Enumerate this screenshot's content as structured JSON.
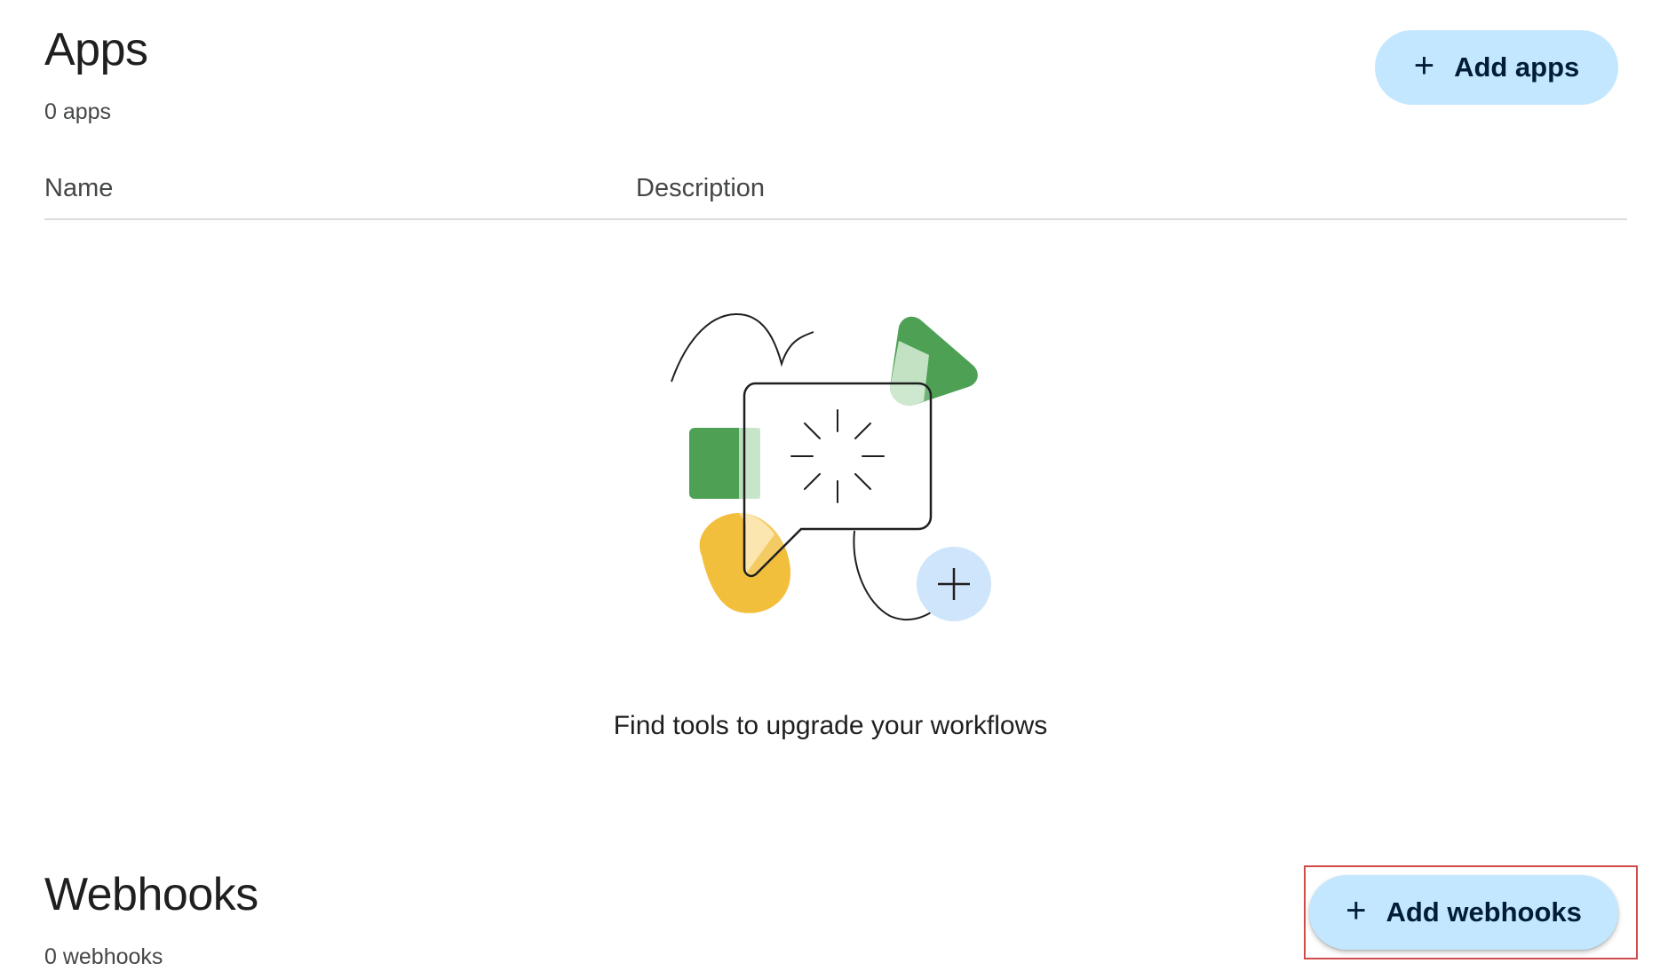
{
  "apps": {
    "title": "Apps",
    "count": "0 apps",
    "add_button_label": "Add apps"
  },
  "table": {
    "columns": [
      "Name",
      "Description"
    ]
  },
  "empty_state": {
    "illustration_icon": "chat-bubble-sparkle-illustration",
    "message": "Find tools to upgrade your workflows"
  },
  "webhooks": {
    "title": "Webhooks",
    "count": "0 webhooks",
    "add_button_label": "Add webhooks"
  },
  "colors": {
    "button_bg": "#c2e7ff",
    "button_text": "#001d35",
    "green": "#4ea055",
    "light_green": "#c8e6c9",
    "yellow": "#f2bf3c",
    "light_blue": "#cfe5fb",
    "highlight_border": "#d24b4b"
  }
}
